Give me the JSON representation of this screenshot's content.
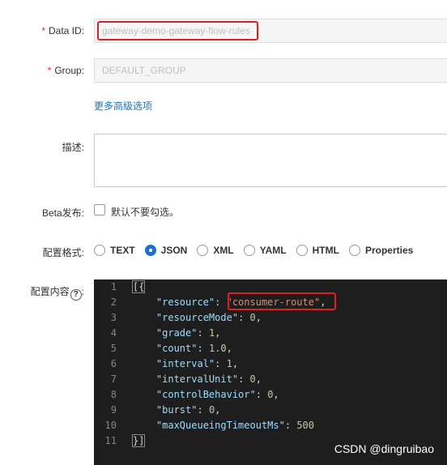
{
  "form": {
    "data_id": {
      "label": "Data ID:",
      "value": "gateway-demo-gateway-flow-rules"
    },
    "group": {
      "label": "Group:",
      "value": "DEFAULT_GROUP"
    },
    "advanced_link": "更多高级选项",
    "description": {
      "label": "描述:",
      "value": ""
    },
    "beta": {
      "label": "Beta发布:",
      "checkbox_text": "默认不要勾选。",
      "checked": false
    },
    "format": {
      "label": "配置格式:",
      "options": [
        "TEXT",
        "JSON",
        "XML",
        "YAML",
        "HTML",
        "Properties"
      ],
      "selected": "JSON"
    },
    "content": {
      "label": "配置内容",
      "help_icon": "question-circle-icon"
    }
  },
  "editor": {
    "line_numbers": [
      "1",
      "2",
      "3",
      "4",
      "5",
      "6",
      "7",
      "8",
      "9",
      "10",
      "11"
    ],
    "json": {
      "open": "[{",
      "close": "}]",
      "items": [
        {
          "key": "\"resource\"",
          "value": "\"consumer-route\"",
          "kind": "string",
          "comma": ","
        },
        {
          "key": "\"resourceMode\"",
          "value": "0",
          "kind": "number",
          "comma": ","
        },
        {
          "key": "\"grade\"",
          "value": "1",
          "kind": "number",
          "comma": ","
        },
        {
          "key": "\"count\"",
          "value": "1.0",
          "kind": "number",
          "comma": ","
        },
        {
          "key": "\"interval\"",
          "value": "1",
          "kind": "number",
          "comma": ","
        },
        {
          "key": "\"intervalUnit\"",
          "value": "0",
          "kind": "number",
          "comma": ","
        },
        {
          "key": "\"controlBehavior\"",
          "value": "0",
          "kind": "number",
          "comma": ","
        },
        {
          "key": "\"burst\"",
          "value": "0",
          "kind": "number",
          "comma": ","
        },
        {
          "key": "\"maxQueueingTimeoutMs\"",
          "value": "500",
          "kind": "number",
          "comma": ""
        }
      ]
    }
  },
  "watermark": "CSDN @dingruibao",
  "colors": {
    "highlight": "#e02020",
    "accent": "#1c6fd0",
    "required": "#f5222d",
    "editor_bg": "#1e1e1e"
  }
}
